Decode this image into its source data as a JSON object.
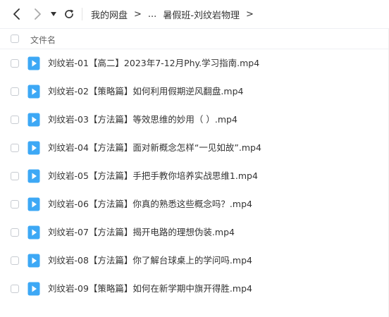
{
  "toolbar": {
    "back_icon": "chevron-left-icon",
    "forward_icon": "chevron-right-icon",
    "history_icon": "dropdown-triangle-icon",
    "refresh_icon": "refresh-icon"
  },
  "breadcrumb": {
    "root": "我的网盘",
    "sep1": ">",
    "ellipsis": "...",
    "current": "暑假班-刘纹岩物理",
    "sep2": ">"
  },
  "columns": {
    "name": "文件名"
  },
  "colors": {
    "file_icon": "#3da8f5",
    "text": "#333333",
    "header_text": "#666666"
  },
  "files": [
    {
      "name": "刘纹岩-01【高二】2023年7-12月Phy.学习指南.mp4"
    },
    {
      "name": "刘纹岩-02【策略篇】如何利用假期逆风翻盘.mp4"
    },
    {
      "name": "刘纹岩-03【方法篇】等效思维的妙用（ ）.mp4"
    },
    {
      "name": "刘纹岩-04【方法篇】面对新概念怎样“一见如故”.mp4"
    },
    {
      "name": "刘纹岩-05【方法篇】手把手教你培养实战思维1.mp4"
    },
    {
      "name": "刘纹岩-06【方法篇】你真的熟悉这些概念吗？.mp4"
    },
    {
      "name": "刘纹岩-07【方法篇】揭开电路的理想伪装.mp4"
    },
    {
      "name": "刘纹岩-08【方法篇】你了解台球桌上的学问吗.mp4"
    },
    {
      "name": "刘纹岩-09【策略篇】如何在新学期中旗开得胜.mp4"
    }
  ]
}
